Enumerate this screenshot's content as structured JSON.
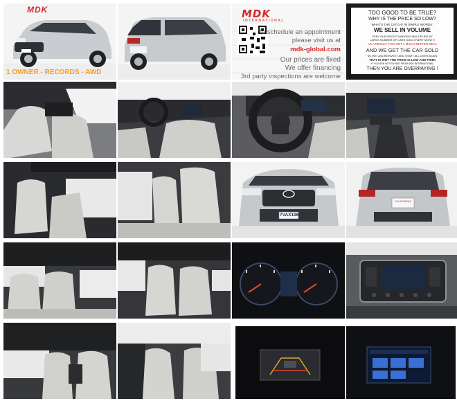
{
  "listing": {
    "banner_logo": "MDK",
    "banner_tagline": "1 OWNER - RECORDS - AWD"
  },
  "ad": {
    "logo": "MDK",
    "logo_sub": "INTERNATIONAL",
    "line1": "To schedule an appointment",
    "line2": "please visit us at",
    "url": "mdk-global.com",
    "line3": "Our prices are fixed",
    "line4": "We offer financing",
    "line5": "3rd party inspections are welcome"
  },
  "promo": {
    "l1": "TOO GOOD TO BE TRUE?",
    "l2": "WHY  IS THE PRICE SO LOW?",
    "l3": "WHAT'S THE CATCH? IN SIMPLE WORDS:",
    "l4": "WE  SELL  IN  VOLUME",
    "l5": "VERY SLIM PROFIT MARGINS MULTIPLIED BY",
    "l6": "LARGE NUMBER OF CARS SOLD EVERY MONTH",
    "l7": "AS A RESULT YOU GET A MUCH BETTER DEAL",
    "l8": "AND WE GET THE CAR SOLD",
    "l9": "SO WE CAN REINVEST AND START ALL OVER AGAIN",
    "l10": "THAT IS WHY THE PRICE IS LOW AND FIRM!",
    "l11": "IF YOU ARE NOT BUYING FROM MDK INTERNATIONAL",
    "l12": "THEN  YOU  ARE OVERPAYING !"
  },
  "plates": {
    "front": "7VAX196",
    "rear": "CALIFORNIA"
  },
  "tiles": [
    {
      "name": "front-three-quarter-photo"
    },
    {
      "name": "rear-three-quarter-photo"
    },
    {
      "name": "dealer-info-ad"
    },
    {
      "name": "price-promo-ad"
    },
    {
      "name": "front-seats-photo"
    },
    {
      "name": "dashboard-from-driver-door-photo"
    },
    {
      "name": "steering-wheel-photo"
    },
    {
      "name": "center-console-photo"
    },
    {
      "name": "second-row-seat-photo"
    },
    {
      "name": "rear-seats-side-photo"
    },
    {
      "name": "front-grille-photo"
    },
    {
      "name": "rear-hatch-photo"
    },
    {
      "name": "rear-seats-from-back-photo"
    },
    {
      "name": "third-row-seats-photo"
    },
    {
      "name": "instrument-cluster-photo"
    },
    {
      "name": "radio-unit-photo"
    },
    {
      "name": "second-row-interior-photo"
    },
    {
      "name": "driver-seat-side-photo"
    },
    {
      "name": "backup-camera-screen-photo"
    },
    {
      "name": "audio-source-screen-photo"
    }
  ]
}
